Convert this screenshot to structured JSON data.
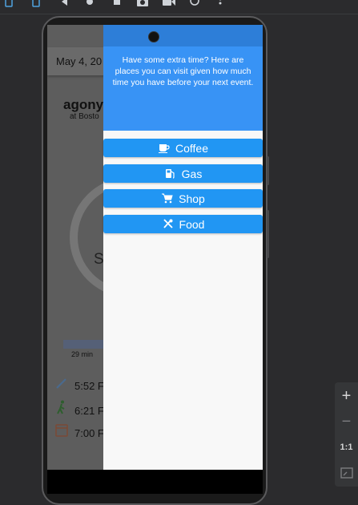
{
  "toolbar": {
    "icons": [
      "rotate-left-icon",
      "rotate-right-icon",
      "back-icon",
      "home-icon",
      "overview-icon",
      "screenshot-icon",
      "camera-record-icon",
      "replay-icon",
      "more-vert-icon"
    ]
  },
  "background_app": {
    "date": "May 4, 20",
    "title": "agony",
    "subtitle": "at Bosto",
    "ring_text": "S",
    "progress_label": "29 min",
    "rows": [
      {
        "icon": "pen-icon",
        "time": "5:52 F"
      },
      {
        "icon": "walking-icon",
        "time": "6:21 F"
      },
      {
        "icon": "calendar-icon",
        "time": "7:00 F"
      }
    ]
  },
  "panel": {
    "message": "Have some extra time? Here are places you can visit given how much time you have before your next event.",
    "buttons": [
      {
        "label": "Coffee",
        "icon": "coffee-icon"
      },
      {
        "label": "Gas",
        "icon": "gas-station-icon"
      },
      {
        "label": "Shop",
        "icon": "shopping-cart-icon"
      },
      {
        "label": "Food",
        "icon": "restaurant-icon"
      }
    ]
  },
  "emulator_controls": {
    "zoom_in": "+",
    "zoom_out": "−",
    "actual_size": "1:1"
  },
  "colors": {
    "panel_header": "#3893f5",
    "button_blue": "#2196f3"
  }
}
